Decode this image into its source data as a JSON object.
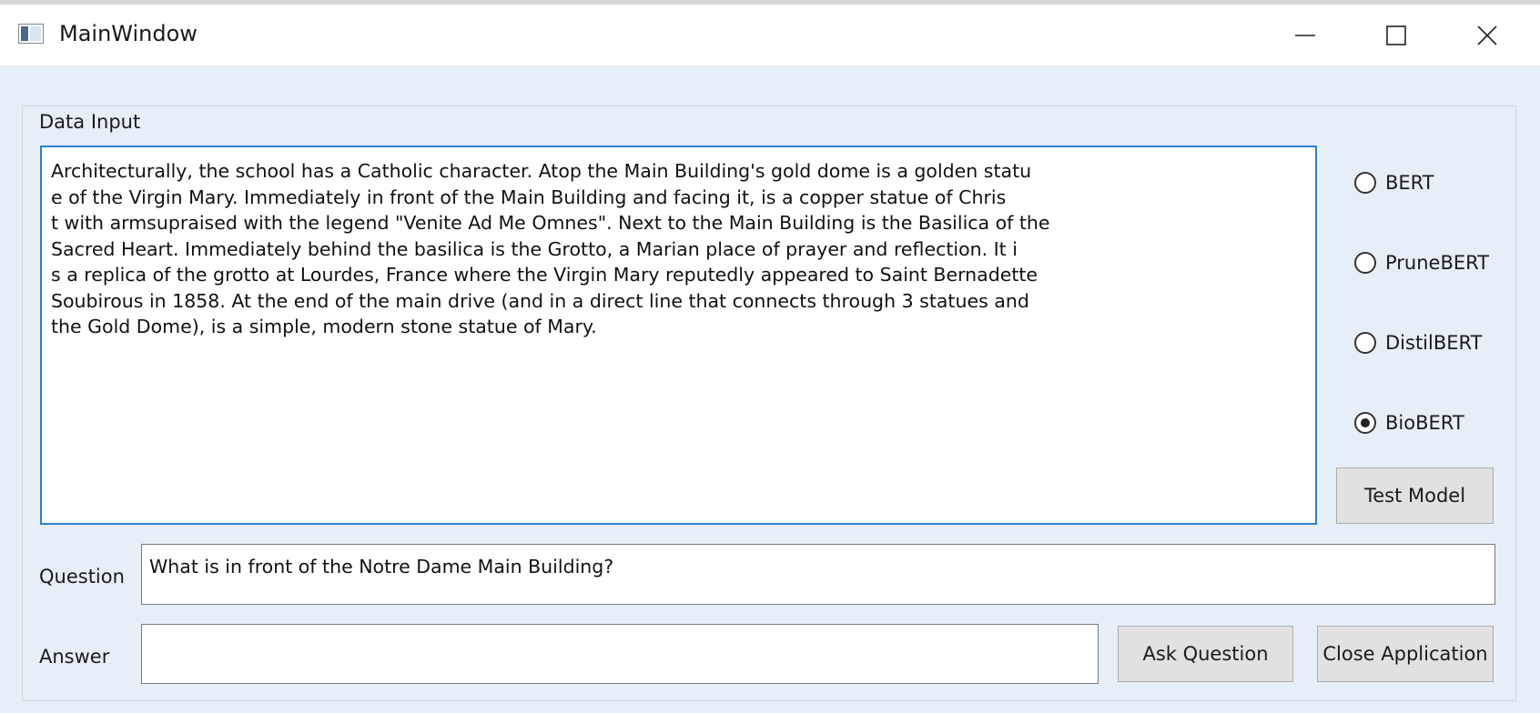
{
  "window": {
    "title": "MainWindow",
    "controls": {
      "minimize_icon": "minimize-icon",
      "maximize_icon": "maximize-icon",
      "close_icon": "close-icon"
    }
  },
  "data_input": {
    "group_title": "Data Input",
    "text": "Architecturally, the school has a Catholic character. Atop the Main Building's gold dome is a golden statu\ne of the Virgin Mary. Immediately in front of the Main Building and facing it, is a copper statue of Chris\nt with armsupraised with the legend \"Venite Ad Me Omnes\". Next to the Main Building is the Basilica of the\nSacred Heart. Immediately behind the basilica is the Grotto, a Marian place of prayer and reflection. It i\ns a replica of the grotto at Lourdes, France where the Virgin Mary reputedly appeared to Saint Bernadette\nSoubirous in 1858. At the end of the main drive (and in a direct line that connects through 3 statues and\nthe Gold Dome), is a simple, modern stone statue of Mary."
  },
  "models": {
    "options": [
      {
        "label": "BERT",
        "checked": false
      },
      {
        "label": "PruneBERT",
        "checked": false
      },
      {
        "label": "DistilBERT",
        "checked": false
      },
      {
        "label": "BioBERT",
        "checked": true
      }
    ],
    "test_button": "Test Model"
  },
  "question": {
    "label": "Question",
    "value": "What is in front of the Notre Dame Main Building?"
  },
  "answer": {
    "label": "Answer",
    "value": ""
  },
  "buttons": {
    "ask": "Ask Question",
    "close": "Close Application"
  },
  "colors": {
    "window_bg": "#e6eef8",
    "focus_border": "#2f7fd1",
    "button_bg": "#e1e1e1"
  }
}
